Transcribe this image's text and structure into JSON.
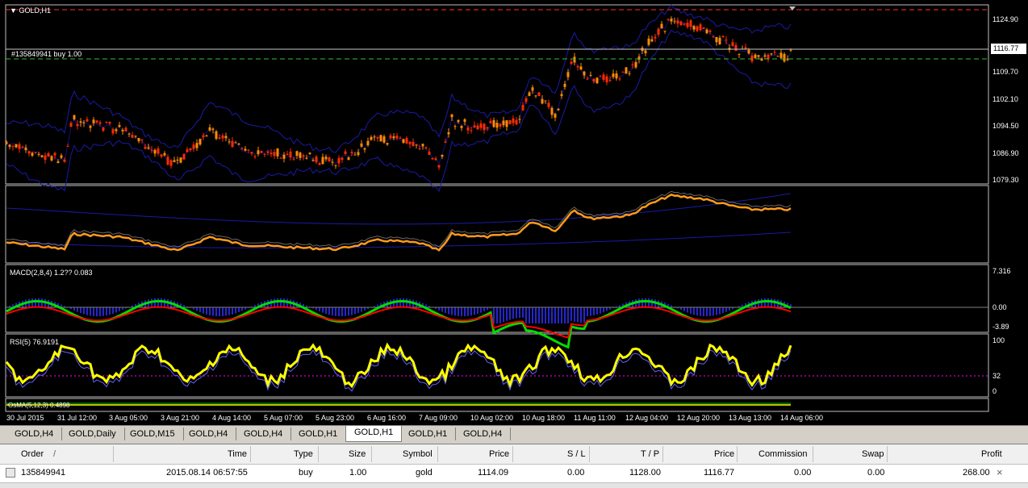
{
  "chart": {
    "symbol_label": "GOLD,H1",
    "order_line_label": "#135849941 buy 1.00",
    "current_price": "1116.77",
    "price_scale": [
      "1124.90",
      "1109.70",
      "1102.10",
      "1094.50",
      "1086.90",
      "1079.30"
    ],
    "macd_label": "MACD(2,8,4) 1.2?? 0.083",
    "macd_scale": [
      "7.316",
      "0.00",
      "-3.89"
    ],
    "rsi_label": "RSI(5) 76.9191",
    "rsi_scale": [
      "100",
      "32",
      "0"
    ],
    "osma_label": "OsMA(5,12,3) 0.4898",
    "time_scale": [
      "30 Jul 2015",
      "31 Jul 12:00",
      "3 Aug 05:00",
      "3 Aug 21:00",
      "4 Aug 14:00",
      "5 Aug 07:00",
      "5 Aug 23:00",
      "6 Aug 16:00",
      "7 Aug 09:00",
      "10 Aug 02:00",
      "10 Aug 18:00",
      "11 Aug 11:00",
      "12 Aug 04:00",
      "12 Aug 20:00",
      "13 Aug 13:00",
      "14 Aug 06:00"
    ],
    "colors": {
      "bull": "#ff8a00",
      "bear": "#ff2a00",
      "bands": "#1a1aa8",
      "rsi": "#ffff00",
      "macd_fast": "#00dd00",
      "macd_slow": "#ff0000",
      "orange_line": "#ff9a1a"
    }
  },
  "tabs": [
    "GOLD,H4",
    "GOLD,Daily",
    "GOLD,M15",
    "GOLD,H4",
    "GOLD,H4",
    "GOLD,H1",
    "GOLD,H1",
    "GOLD,H1",
    "GOLD,H4"
  ],
  "active_tab": 6,
  "terminal": {
    "headers": [
      "Order",
      "/",
      "Time",
      "Type",
      "Size",
      "Symbol",
      "Price",
      "S / L",
      "T / P",
      "Price",
      "Commission",
      "Swap",
      "Profit"
    ],
    "row": {
      "order": "135849941",
      "time": "2015.08.14 06:57:55",
      "type": "buy",
      "size": "1.00",
      "symbol": "gold",
      "price": "1114.09",
      "sl": "0.00",
      "tp": "1128.00",
      "cur_price": "1116.77",
      "commission": "0.00",
      "swap": "0.00",
      "profit": "268.00"
    }
  }
}
